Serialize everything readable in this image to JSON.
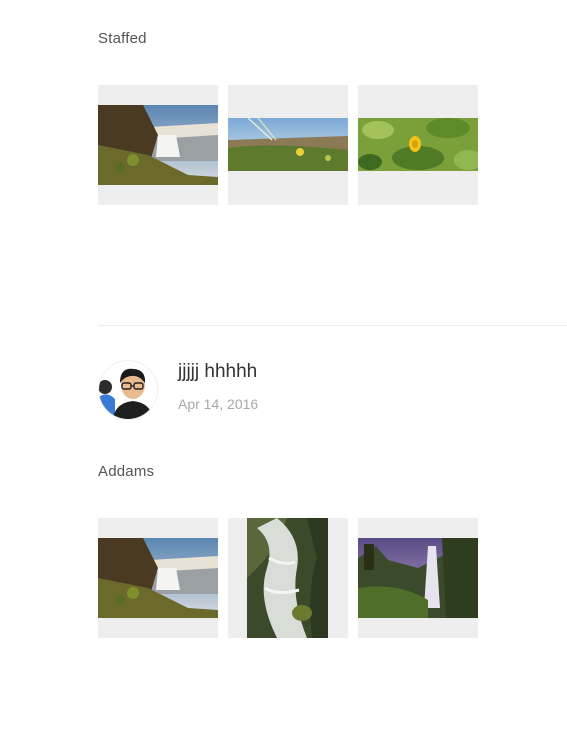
{
  "albums": [
    {
      "title": "Staffed",
      "photos": [
        {
          "subject": "waterfall-coast"
        },
        {
          "subject": "grass-closeup"
        },
        {
          "subject": "yellow-flower-leaves"
        }
      ]
    },
    {
      "title": "Addams",
      "photos": [
        {
          "subject": "waterfall-coast"
        },
        {
          "subject": "long-exposure-stream"
        },
        {
          "subject": "misty-waterfall-cliff"
        }
      ]
    }
  ],
  "post": {
    "author_name": "jjjjj hhhhh",
    "date": "Apr 14, 2016"
  }
}
